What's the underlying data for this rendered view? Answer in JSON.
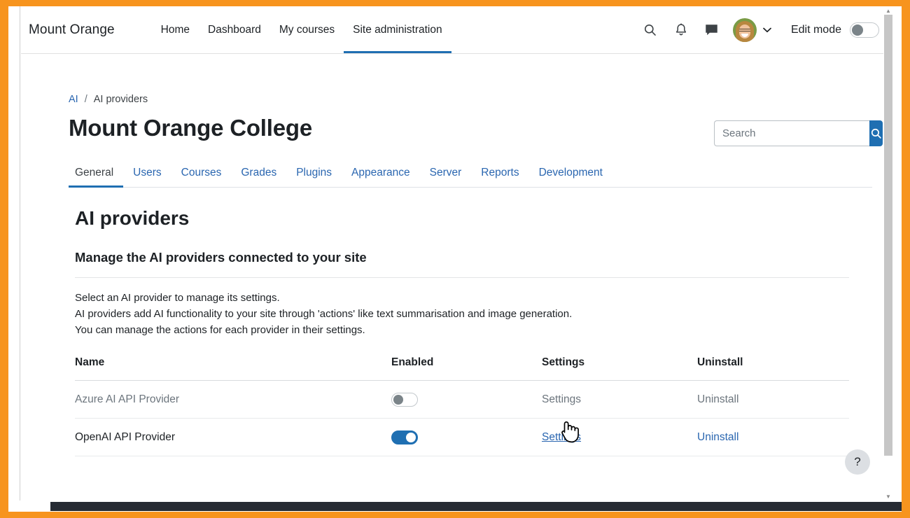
{
  "navbar": {
    "brand": "Mount Orange",
    "links": [
      {
        "label": "Home",
        "active": false
      },
      {
        "label": "Dashboard",
        "active": false
      },
      {
        "label": "My courses",
        "active": false
      },
      {
        "label": "Site administration",
        "active": true
      }
    ],
    "icons": [
      {
        "name": "search-icon"
      },
      {
        "name": "bell-icon"
      },
      {
        "name": "message-icon"
      }
    ],
    "avatar_alt": "user-avatar",
    "chevron": "chevron-down-icon",
    "edit_mode_label": "Edit mode",
    "edit_mode_on": false
  },
  "breadcrumb": {
    "root": "AI",
    "separator": "/",
    "current": "AI providers"
  },
  "header": {
    "site_title": "Mount Orange College"
  },
  "search": {
    "placeholder": "Search",
    "value": "",
    "button_icon": "search-icon"
  },
  "tabs": [
    {
      "label": "General",
      "active": true
    },
    {
      "label": "Users",
      "active": false
    },
    {
      "label": "Courses",
      "active": false
    },
    {
      "label": "Grades",
      "active": false
    },
    {
      "label": "Plugins",
      "active": false
    },
    {
      "label": "Appearance",
      "active": false
    },
    {
      "label": "Server",
      "active": false
    },
    {
      "label": "Reports",
      "active": false
    },
    {
      "label": "Development",
      "active": false
    }
  ],
  "main": {
    "page_heading": "AI providers",
    "section_heading": "Manage the AI providers connected to your site",
    "description_lines": [
      "Select an AI provider to manage its settings.",
      "AI providers add AI functionality to your site through 'actions' like text summarisation and image generation.",
      "You can manage the actions for each provider in their settings."
    ]
  },
  "table": {
    "columns": [
      "Name",
      "Enabled",
      "Settings",
      "Uninstall"
    ],
    "rows": [
      {
        "name": "Azure AI API Provider",
        "enabled": false,
        "settings_label": "Settings",
        "uninstall_label": "Uninstall",
        "muted": true,
        "settings_hovered": false
      },
      {
        "name": "OpenAI API Provider",
        "enabled": true,
        "settings_label": "Settings",
        "uninstall_label": "Uninstall",
        "muted": false,
        "settings_hovered": true
      }
    ]
  },
  "help": {
    "label": "?"
  },
  "colors": {
    "frame_orange": "#F7941E",
    "accent_blue": "#1f6fb2",
    "link_blue": "#2a66b0",
    "muted_grey": "#6c757d",
    "text_dark": "#1d2125",
    "scrollbar_dark": "#262b33"
  }
}
